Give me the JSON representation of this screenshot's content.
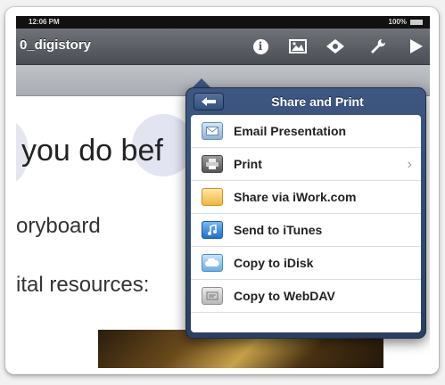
{
  "status_bar": {
    "time": "12:06 PM",
    "battery": "100%"
  },
  "toolbar": {
    "document_title": "0_digistory",
    "icons": [
      "info-icon",
      "image-icon",
      "diamond-icon",
      "wrench-icon",
      "play-icon"
    ]
  },
  "slide": {
    "heading": "you do bef",
    "line1": "oryboard",
    "line2": "ital resources:"
  },
  "popover": {
    "title": "Share and Print",
    "back_icon": "arrow-left-icon",
    "items": [
      {
        "label": "Email Presentation",
        "icon": "envelope-icon"
      },
      {
        "label": "Print",
        "icon": "printer-icon",
        "has_chevron": true
      },
      {
        "label": "Share via iWork.com",
        "icon": "iwork-icon"
      },
      {
        "label": "Send to iTunes",
        "icon": "itunes-icon"
      },
      {
        "label": "Copy to iDisk",
        "icon": "idisk-icon"
      },
      {
        "label": "Copy to WebDAV",
        "icon": "webdav-icon"
      }
    ],
    "chevron": "›"
  },
  "colors": {
    "toolbar": "#5c6066",
    "popover": "#34507c",
    "accent": "#3d5782"
  }
}
